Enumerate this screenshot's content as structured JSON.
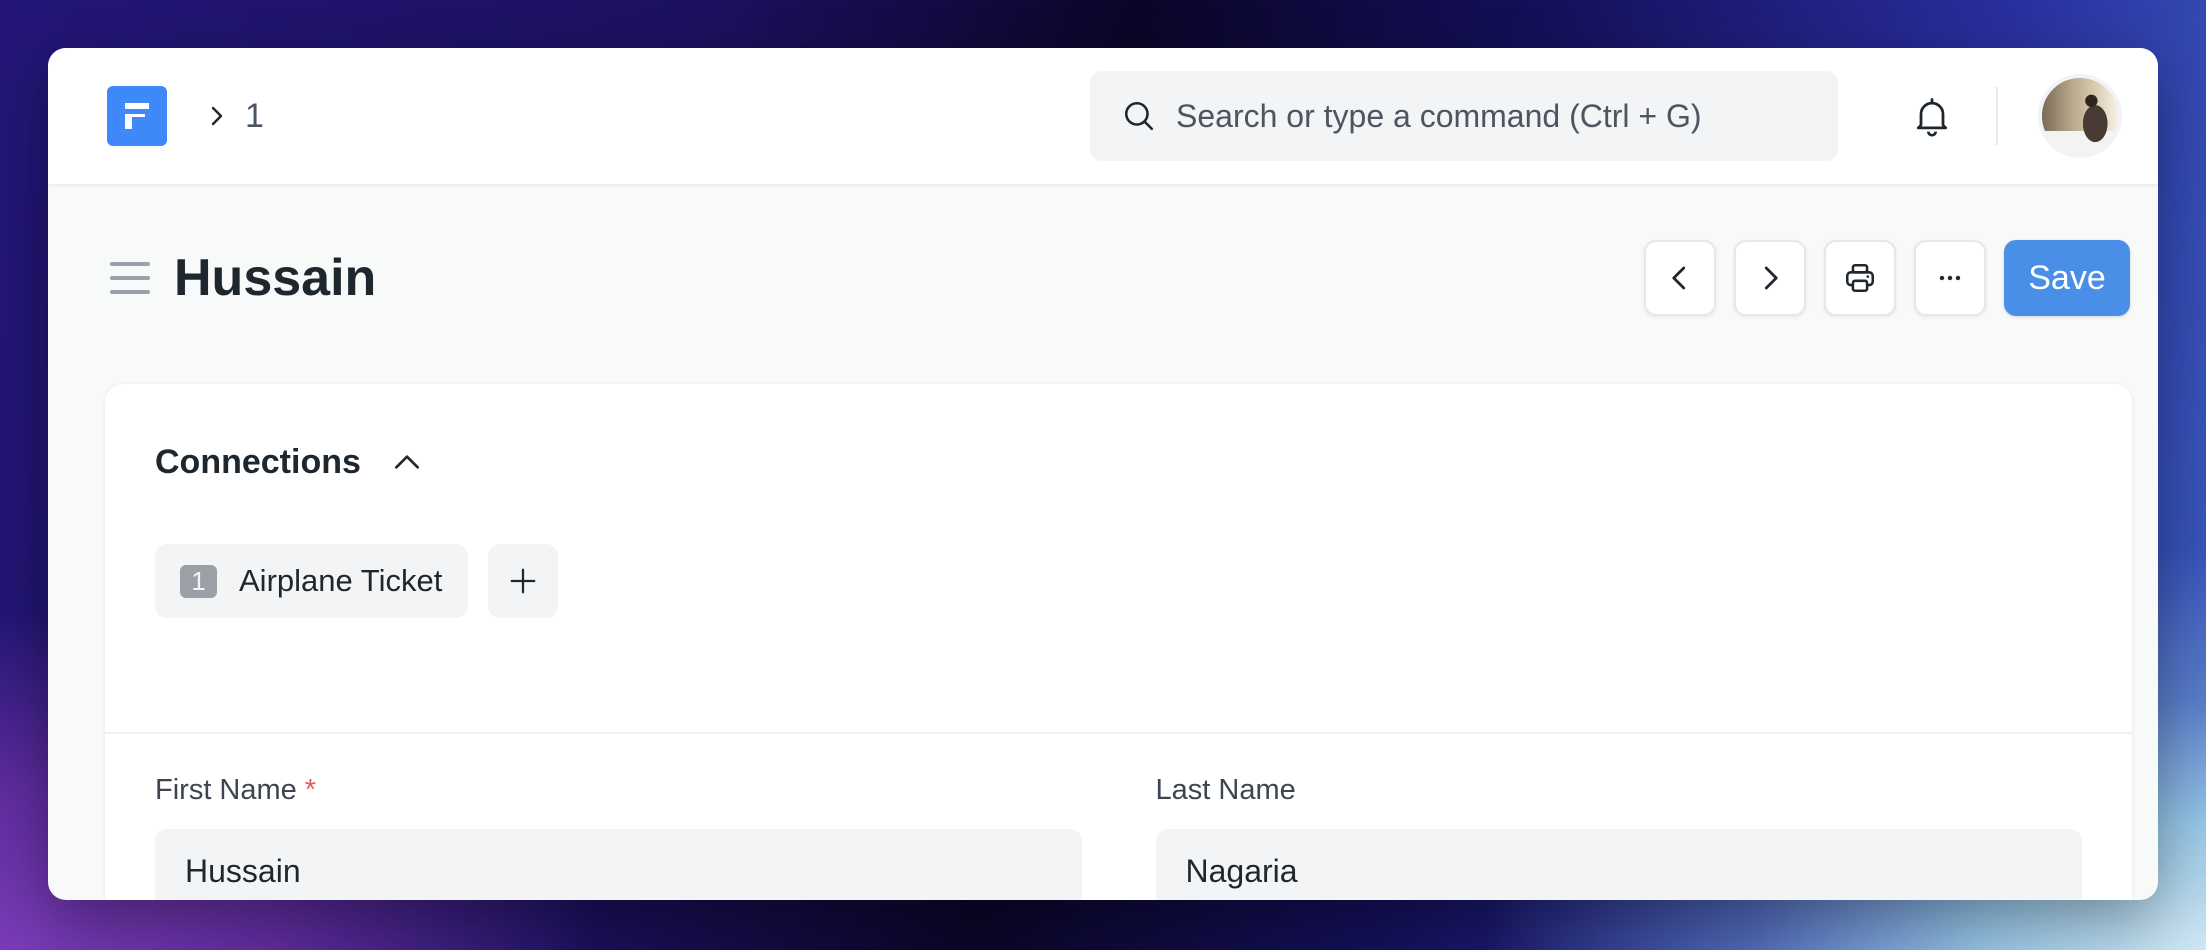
{
  "navbar": {
    "logo_letter": "F",
    "breadcrumb": [
      "1"
    ],
    "search_placeholder": "Search or type a command (Ctrl + G)",
    "icons": {
      "search": "search-icon",
      "notifications": "bell-icon",
      "avatar": "user-avatar"
    }
  },
  "page": {
    "title": "Hussain",
    "actions": {
      "prev": "chevron-left-icon",
      "next": "chevron-right-icon",
      "print": "printer-icon",
      "more": "ellipsis-icon",
      "save_label": "Save"
    }
  },
  "connections": {
    "title": "Connections",
    "items": [
      {
        "count": "1",
        "label": "Airplane Ticket"
      }
    ]
  },
  "form": {
    "fields": [
      {
        "label": "First Name",
        "required_mark": "*",
        "value": "Hussain"
      },
      {
        "label": "Last Name",
        "required_mark": "",
        "value": "Nagaria"
      }
    ]
  },
  "colors": {
    "primary": "#3e89f7",
    "save_button": "#4a8fe7",
    "required": "#e15c5c",
    "input_bg": "#f3f4f6"
  }
}
